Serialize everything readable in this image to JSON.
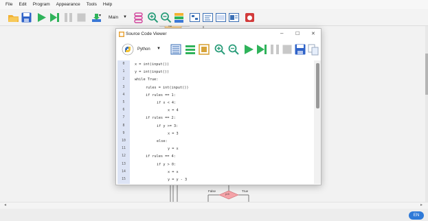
{
  "menubar": {
    "items": [
      "File",
      "Edit",
      "Program",
      "Appearance",
      "Tools",
      "Help"
    ]
  },
  "toolbar": {
    "main_select_value": "Main",
    "icons": [
      "open-folder-icon",
      "save-icon",
      "run-icon",
      "step-icon",
      "pause-icon",
      "stop-icon",
      "export-icon",
      "main-selector",
      "variables-icon",
      "zoom-in-icon",
      "zoom-out-icon",
      "layers-icon",
      "flowchart-view-icon",
      "code-view-icon",
      "console-icon",
      "settings-icon",
      "bug-icon"
    ]
  },
  "viewer": {
    "title": "Source Code Viewer",
    "language": "Python",
    "controls": {
      "minimize": "–",
      "maximize": "☐",
      "close": "✕"
    },
    "lines": [
      {
        "n": "0",
        "text": "x = int(input())",
        "indent": 0
      },
      {
        "n": "1",
        "text": "y = int(input())",
        "indent": 0
      },
      {
        "n": "2",
        "text": "while True:",
        "indent": 0
      },
      {
        "n": "3",
        "text": "rules = int(input())",
        "indent": 1
      },
      {
        "n": "4",
        "text": "if rules == 1:",
        "indent": 1
      },
      {
        "n": "5",
        "text": "if x < 4:",
        "indent": 2
      },
      {
        "n": "6",
        "text": "x = 4",
        "indent": 3
      },
      {
        "n": "7",
        "text": "if rules == 2:",
        "indent": 1
      },
      {
        "n": "8",
        "text": "if y >= 3:",
        "indent": 2
      },
      {
        "n": "9",
        "text": "x = 3",
        "indent": 3
      },
      {
        "n": "10",
        "text": "else:",
        "indent": 2
      },
      {
        "n": "11",
        "text": "y = x",
        "indent": 3
      },
      {
        "n": "12",
        "text": "if rules == 4:",
        "indent": 1
      },
      {
        "n": "13",
        "text": "if y > 0:",
        "indent": 2
      },
      {
        "n": "14",
        "text": "x = x",
        "indent": 3
      },
      {
        "n": "15",
        "text": "y = y - 3",
        "indent": 3
      }
    ]
  },
  "canvas": {
    "false_label": "False",
    "true_label": "True",
    "decision_text": "y>0",
    "top_node_text": "true"
  },
  "statusbar": {
    "language_badge": "EN"
  },
  "colors": {
    "accent_blue": "#2f7ad8",
    "gutter_bg": "#dde4f5",
    "decision_fill": "#f5a3a8"
  }
}
